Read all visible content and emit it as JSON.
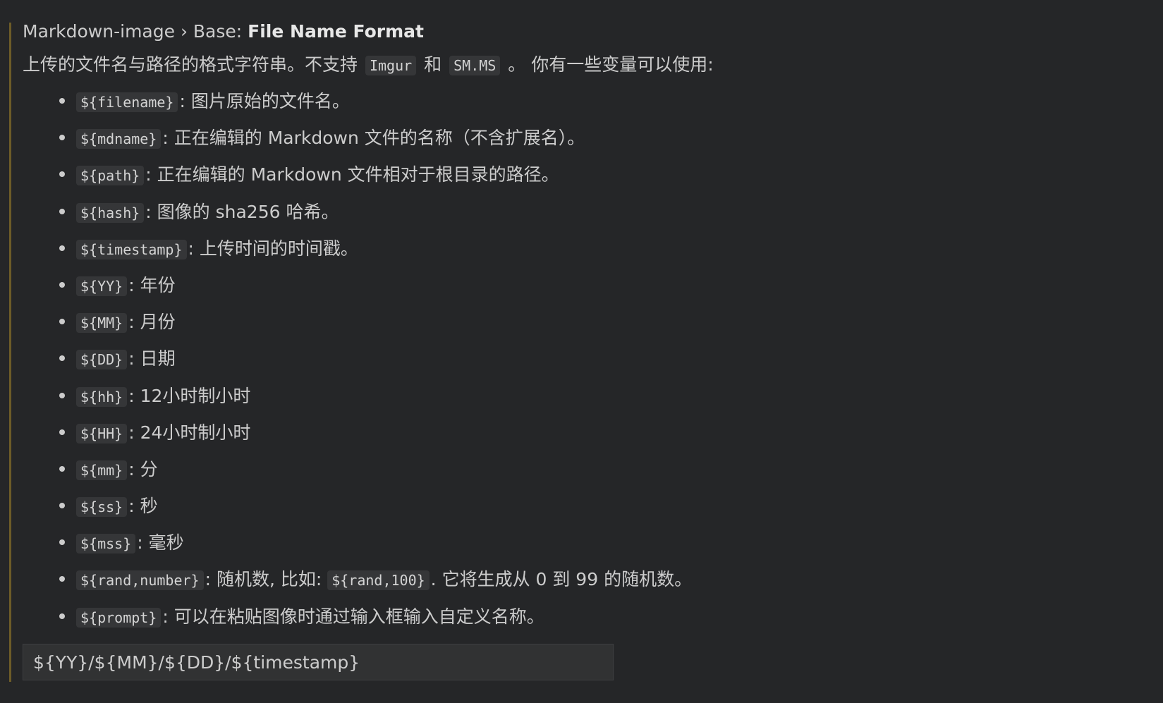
{
  "setting": {
    "category": "Markdown-image › Base: ",
    "name": "File Name Format",
    "description": {
      "before": "上传的文件名与路径的格式字符串。不支持",
      "code1": "Imgur",
      "middle": "和",
      "code2": "SM.MS",
      "after": "。 你有一些变量可以使用:"
    },
    "variables": [
      {
        "code": "${filename}",
        "text": ": 图片原始的文件名。"
      },
      {
        "code": "${mdname}",
        "text": ": 正在编辑的 Markdown 文件的名称（不含扩展名）。"
      },
      {
        "code": "${path}",
        "text": ": 正在编辑的 Markdown 文件相对于根目录的路径。"
      },
      {
        "code": "${hash}",
        "text": ": 图像的 sha256 哈希。"
      },
      {
        "code": "${timestamp}",
        "text": ": 上传时间的时间戳。"
      },
      {
        "code": "${YY}",
        "text": ": 年份"
      },
      {
        "code": "${MM}",
        "text": ": 月份"
      },
      {
        "code": "${DD}",
        "text": ": 日期"
      },
      {
        "code": "${hh}",
        "text": ": 12小时制小时"
      },
      {
        "code": "${HH}",
        "text": ": 24小时制小时"
      },
      {
        "code": "${mm}",
        "text": ": 分"
      },
      {
        "code": "${ss}",
        "text": ": 秒"
      },
      {
        "code": "${mss}",
        "text": ": 毫秒"
      },
      {
        "code": "${rand,number}",
        "text": ": 随机数, 比如: ",
        "code2": "${rand,100}",
        "text2": ". 它将生成从 0 到 99 的随机数。"
      },
      {
        "code": "${prompt}",
        "text": ": 可以在粘贴图像时通过输入框输入自定义名称。"
      }
    ],
    "value": "${YY}/${MM}/${DD}/${timestamp}"
  },
  "colors": {
    "background": "#252628",
    "modified_indicator": "#6d5c28",
    "code_background": "#353638",
    "input_background": "#313233"
  }
}
